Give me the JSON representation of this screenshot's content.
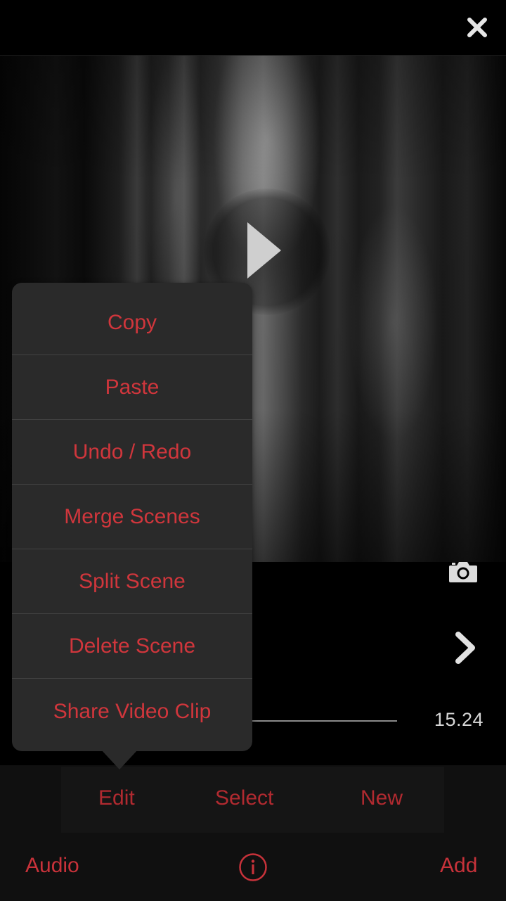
{
  "header": {
    "close_icon": "close-icon"
  },
  "preview": {
    "play_icon": "play-icon"
  },
  "clip": {
    "camera_icon": "camera-icon",
    "next_icon": "chevron-right-icon",
    "duration": "15.24"
  },
  "popover": {
    "items": [
      {
        "label": "Copy"
      },
      {
        "label": "Paste"
      },
      {
        "label": "Undo / Redo"
      },
      {
        "label": "Merge Scenes"
      },
      {
        "label": "Split Scene"
      },
      {
        "label": "Delete Scene"
      },
      {
        "label": "Share Video Clip"
      }
    ]
  },
  "toolbar": {
    "edit_label": "Edit",
    "select_label": "Select",
    "new_label": "New"
  },
  "bottom": {
    "audio_label": "Audio",
    "info_icon": "info-icon",
    "add_label": "Add"
  },
  "colors": {
    "accent": "#d0363c",
    "menu_bg": "#2a2a2a",
    "background": "#000000"
  }
}
